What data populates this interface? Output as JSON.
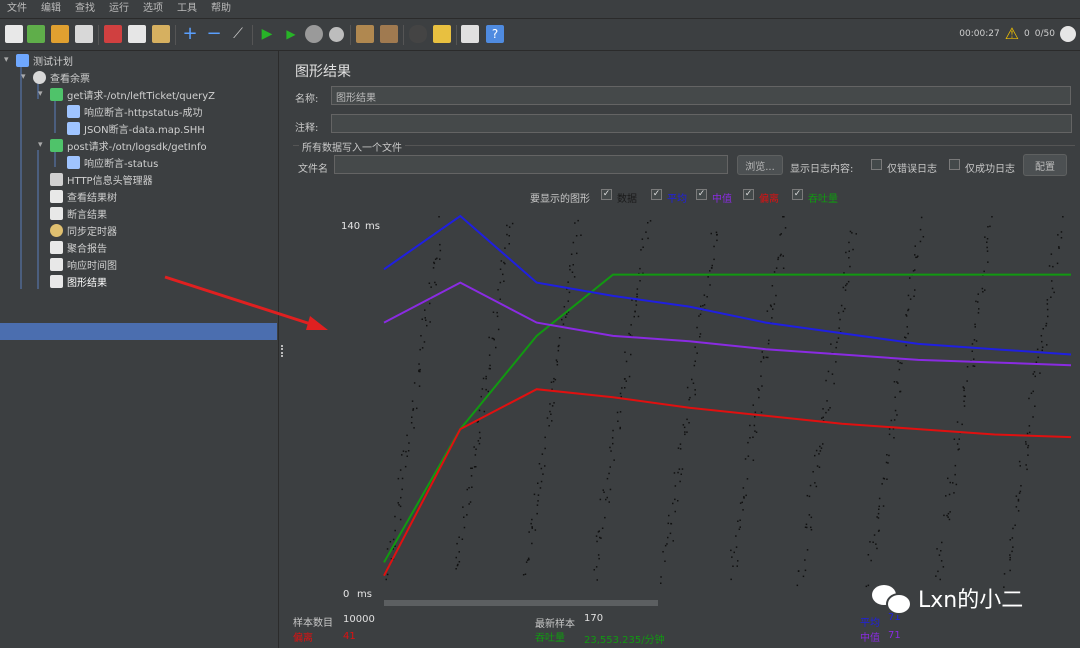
{
  "menu": [
    "文件",
    "编辑",
    "查找",
    "运行",
    "选项",
    "工具",
    "帮助"
  ],
  "status": {
    "elapsed": "00:00:27",
    "warnings": "0",
    "threads": "0/50"
  },
  "tree": [
    {
      "label": "测试计划",
      "depth": 0,
      "toggle": "▾",
      "icon": "flask-icon"
    },
    {
      "label": "查看余票",
      "depth": 1,
      "toggle": "▾",
      "icon": "gear-icon"
    },
    {
      "label": "get请求-/otn/leftTicket/queryZ",
      "depth": 2,
      "toggle": "▾",
      "icon": "pipette-icon"
    },
    {
      "label": "响应断言-httpstatus-成功",
      "depth": 3,
      "toggle": "",
      "icon": "magnifier-icon"
    },
    {
      "label": "JSON断言-data.map.SHH",
      "depth": 3,
      "toggle": "",
      "icon": "magnifier-icon"
    },
    {
      "label": "post请求-/otn/logsdk/getInfo",
      "depth": 2,
      "toggle": "▾",
      "icon": "pipette-icon"
    },
    {
      "label": "响应断言-status",
      "depth": 3,
      "toggle": "",
      "icon": "magnifier-icon"
    },
    {
      "label": "HTTP信息头管理器",
      "depth": 2,
      "toggle": "",
      "icon": "wrench-icon"
    },
    {
      "label": "查看结果树",
      "depth": 2,
      "toggle": "",
      "icon": "chart-icon"
    },
    {
      "label": "断言结果",
      "depth": 2,
      "toggle": "",
      "icon": "chart-icon"
    },
    {
      "label": "同步定时器",
      "depth": 2,
      "toggle": "",
      "icon": "clock-icon"
    },
    {
      "label": "聚合报告",
      "depth": 2,
      "toggle": "",
      "icon": "chart-icon"
    },
    {
      "label": "响应时间图",
      "depth": 2,
      "toggle": "",
      "icon": "chart-icon"
    },
    {
      "label": "图形结果",
      "depth": 2,
      "toggle": "",
      "icon": "chart-icon",
      "selected": true
    }
  ],
  "panel": {
    "title": "图形结果",
    "name_label": "名称:",
    "name_value": "图形结果",
    "comment_label": "注释:",
    "comment_value": "",
    "file_section": "所有数据写入一个文件",
    "file_label": "文件名",
    "file_value": "",
    "browse_button": "浏览...",
    "log_label": "显示日志内容:",
    "errors_only": "仅错误日志",
    "success_only": "仅成功日志",
    "config_button": "配置",
    "graphs_label": "要显示的图形",
    "legend": [
      {
        "label": "数据",
        "color": "#1a1a1a",
        "checked": true
      },
      {
        "label": "平均",
        "color": "#1f1fe0",
        "checked": true
      },
      {
        "label": "中值",
        "color": "#8a2be2",
        "checked": true
      },
      {
        "label": "偏离",
        "color": "#e01010",
        "checked": true
      },
      {
        "label": "吞吐量",
        "color": "#119911",
        "checked": true
      }
    ]
  },
  "chart_data": {
    "type": "scatter",
    "y_unit": "ms",
    "ylim": [
      0,
      140
    ],
    "ymax_label": "140",
    "ymin_label": "0",
    "series": [
      {
        "name": "吞吐量",
        "color": "#119911",
        "values": [
          10,
          60,
          95,
          118,
          118,
          118,
          118,
          118,
          118,
          118
        ]
      },
      {
        "name": "平均",
        "color": "#1f1fe0",
        "values": [
          120,
          140,
          115,
          110,
          106,
          100,
          96,
          92,
          90,
          88
        ]
      },
      {
        "name": "中值",
        "color": "#8a2be2",
        "values": [
          100,
          115,
          100,
          95,
          93,
          90,
          88,
          86,
          85,
          84
        ]
      },
      {
        "name": "偏离",
        "color": "#e01010",
        "values": [
          5,
          60,
          75,
          72,
          68,
          65,
          62,
          60,
          58,
          57
        ]
      }
    ]
  },
  "footer": {
    "samples_label": "样本数目",
    "samples_value": "10000",
    "deviation_label": "偏离",
    "deviation_value": "41",
    "latest_label": "最新样本",
    "latest_value": "170",
    "throughput_label": "吞吐量",
    "throughput_value": "23,553.235/分钟",
    "average_label": "平均",
    "average_value": "71",
    "median_label": "中值",
    "median_value": "71"
  },
  "watermark": "Lxn的小二"
}
